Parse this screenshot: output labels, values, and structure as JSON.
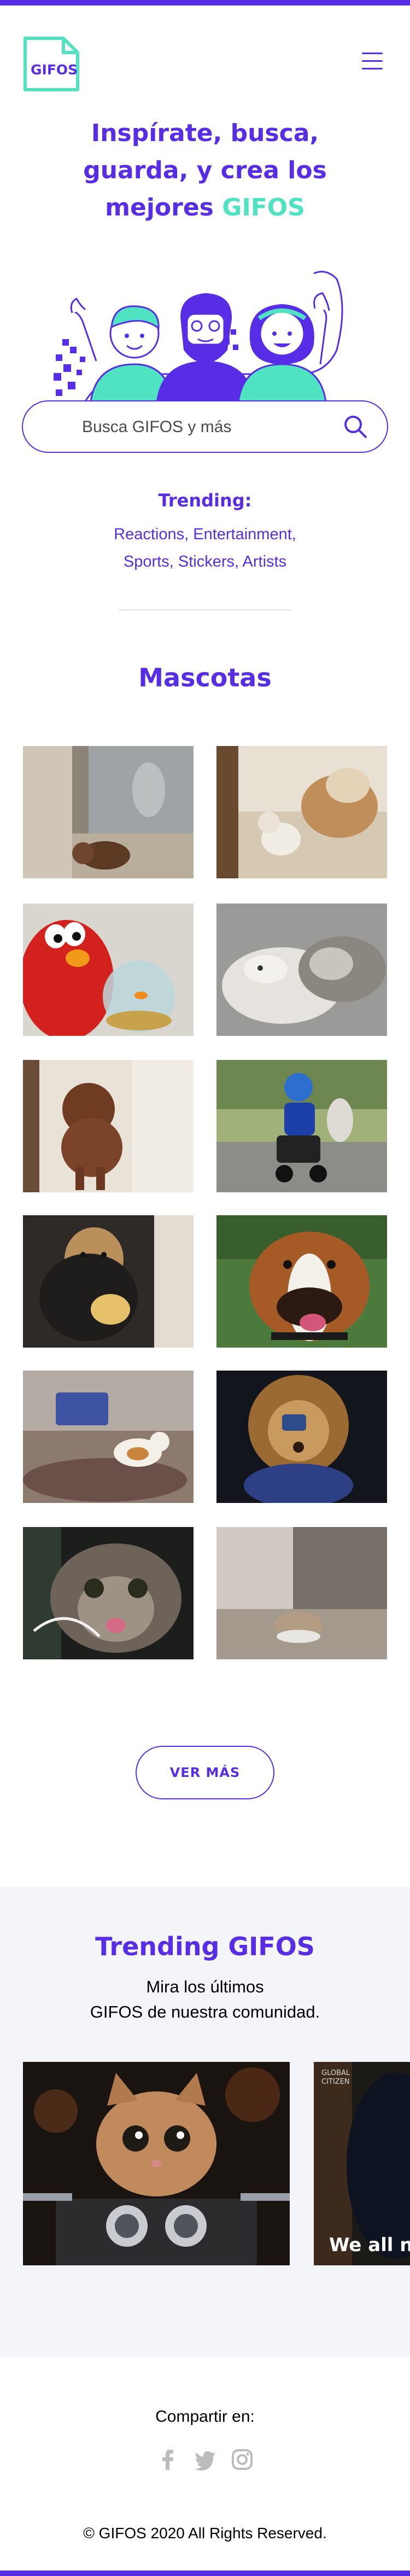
{
  "header": {
    "logo_text": "GIFOS",
    "menu_icon": "hamburger-icon"
  },
  "hero": {
    "title_line1": "Inspírate, busca,",
    "title_line2": "guarda, y crea los",
    "title_line3_prefix": "mejores ",
    "title_line3_accent": "GIFOS"
  },
  "search": {
    "value": "",
    "placeholder": "Busca GIFOS y más",
    "icon": "search-icon"
  },
  "trending_terms": {
    "label": "Trending:",
    "terms": [
      "Reactions",
      "Entertainment",
      "Sports",
      "Stickers",
      "Artists"
    ],
    "separator": ", "
  },
  "results": {
    "title": "Mascotas",
    "gifs": [
      {
        "name": "puppy-by-glass-door"
      },
      {
        "name": "bulldog-and-puppy"
      },
      {
        "name": "elmo-with-fishbowl"
      },
      {
        "name": "cat-and-dog-cuddling"
      },
      {
        "name": "poodle-walking"
      },
      {
        "name": "child-on-scooter-with-dog"
      },
      {
        "name": "dog-eating-chip"
      },
      {
        "name": "boxer-dog-panting"
      },
      {
        "name": "cat-jumping-at-basket"
      },
      {
        "name": "dog-in-lion-costume"
      },
      {
        "name": "cat-tongue-out"
      },
      {
        "name": "cat-in-doorway"
      }
    ],
    "more_button": "VER MÁS"
  },
  "trending_gifos": {
    "title": "Trending GIFOS",
    "subtitle_line1": "Mira los últimos",
    "subtitle_line2": "GIFOS de nuestra comunidad.",
    "gifs": [
      {
        "name": "kitten-on-motorcycle"
      },
      {
        "name": "global-citizen-clip",
        "caption": "We all n",
        "watermark": "GLOBAL CITIZEN"
      }
    ]
  },
  "footer": {
    "share_label": "Compartir en:",
    "social": [
      "facebook-icon",
      "twitter-icon",
      "instagram-icon"
    ],
    "copyright": "© GIFOS 2020 All Rights Reserved."
  },
  "colors": {
    "primary": "#572ee5",
    "accent": "#50e3c2",
    "section_bg": "#f3f5f8",
    "social_icons": "#bcbcbc"
  }
}
